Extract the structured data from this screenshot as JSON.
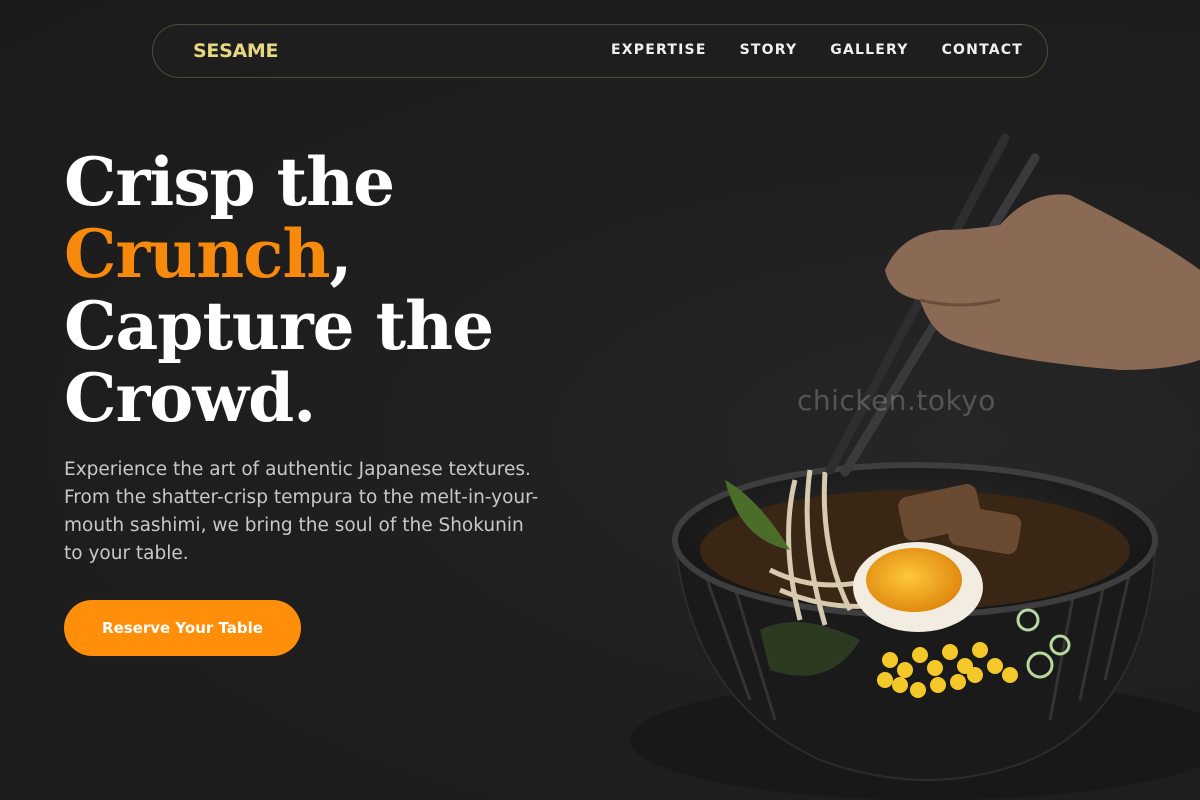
{
  "nav": {
    "brand": "SESAME",
    "links": [
      "EXPERTISE",
      "STORY",
      "GALLERY",
      "CONTACT"
    ]
  },
  "hero": {
    "line1": "Crisp the",
    "line2_accent": "Crunch",
    "line2_tail": ",",
    "line3": "Capture the",
    "line4": "Crowd.",
    "description": "Experience the art of authentic Japanese textures. From the shatter-crisp tempura to the melt-in-your-mouth sashimi, we bring the soul of the Shokunin to your table.",
    "cta_label": "Reserve Your Table",
    "watermark": "chicken.tokyo"
  },
  "colors": {
    "accent": "#f7890c",
    "brand": "#e6d783",
    "background": "#1e1e1e"
  },
  "icons": [
    "ramen-bowl-image",
    "chopsticks-hand-image"
  ]
}
